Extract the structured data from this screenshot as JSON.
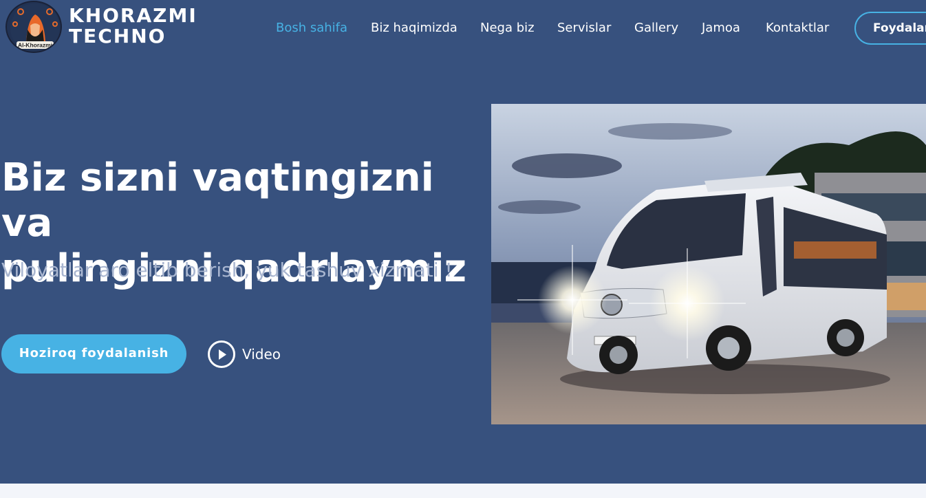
{
  "brand": {
    "line1": "KHORAZMI",
    "line2": "TECHNO",
    "badge_text": "Al-Khorazmi"
  },
  "nav": {
    "items": [
      {
        "label": "Bosh sahifa",
        "active": true
      },
      {
        "label": "Biz haqimizda"
      },
      {
        "label": "Nega biz"
      },
      {
        "label": "Servislar"
      },
      {
        "label": "Gallery"
      },
      {
        "label": "Jamoa"
      },
      {
        "label": "Kontaktlar"
      }
    ],
    "cta_label": "Foydalanish"
  },
  "hero": {
    "title_line1": "Biz sizni vaqtingizni va",
    "title_line2": "pulingizni qadrlaymiz",
    "subtitle": "Viloyatlar aro eltib berish, yuk tashuv xizmati !",
    "primary_button": "Hoziroq foydalanish",
    "video_label": "Video",
    "image_icon": "minibus-photo"
  },
  "colors": {
    "background": "#37517e",
    "accent": "#47b2e4",
    "subtitle": "#a9b6d0"
  }
}
